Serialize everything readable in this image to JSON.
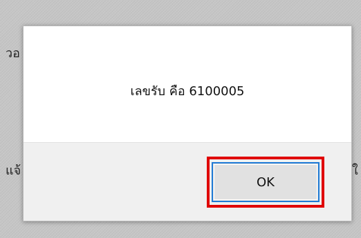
{
  "background": {
    "left_fragment_top": "วอ",
    "left_fragment_bottom": "แจ้",
    "right_fragment_bottom": "ใ"
  },
  "dialog": {
    "message": "เลขรับ คือ 6100005",
    "ok_label": "OK"
  },
  "colors": {
    "highlight": "#e00000",
    "button_border": "#1e7bd6",
    "footer_bg": "#f0f0f0"
  }
}
